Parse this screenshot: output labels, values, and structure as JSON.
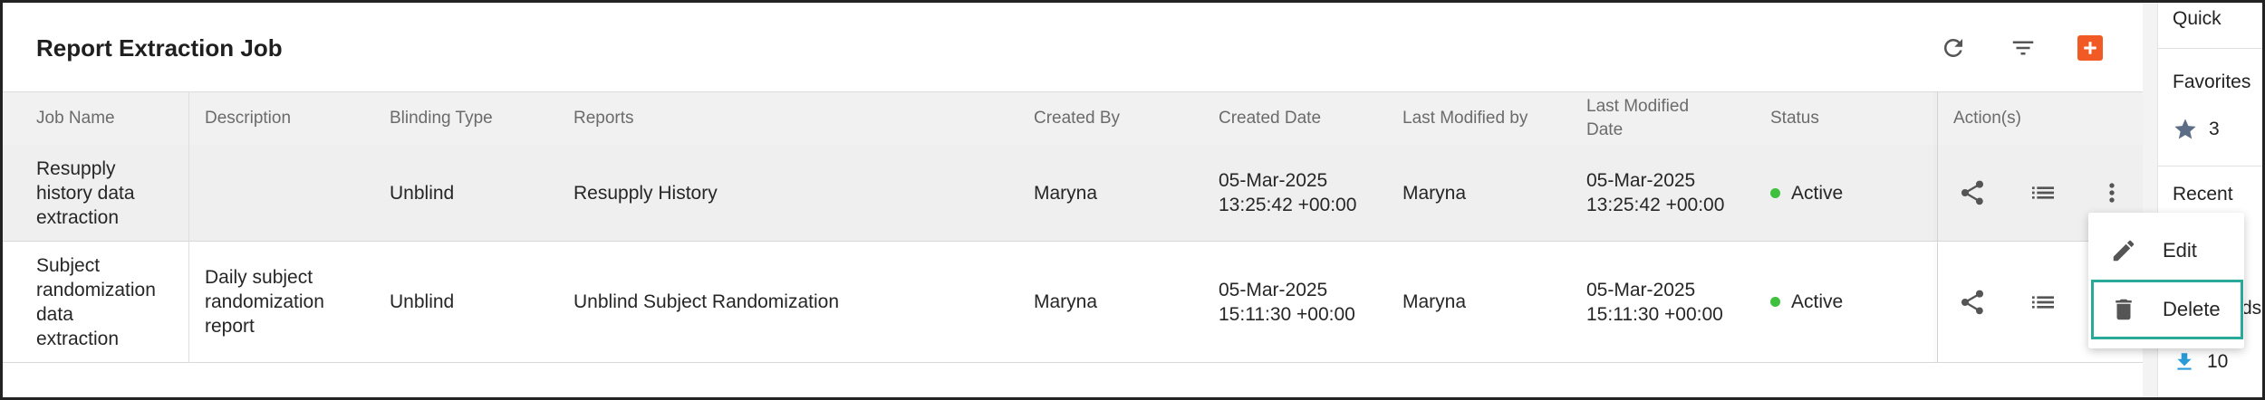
{
  "header": {
    "title": "Report Extraction Job",
    "icons": {
      "refresh": "refresh-icon",
      "filter": "filter-icon",
      "add": "add-icon"
    },
    "add_color": "#f15a24"
  },
  "table": {
    "columns": [
      "Job Name",
      "Description",
      "Blinding Type",
      "Reports",
      "Created By",
      "Created Date",
      "Last Modified by",
      "Last Modified Date",
      "Status",
      "Action(s)"
    ],
    "rows": [
      {
        "job_name": [
          "Resupply",
          "history data",
          "extraction"
        ],
        "description": [],
        "blinding_type": "Unblind",
        "reports": "Resupply History",
        "created_by": "Maryna",
        "created_date": [
          "05-Mar-2025",
          "13:25:42 +00:00"
        ],
        "last_modified_by": "Maryna",
        "last_modified_date": [
          "05-Mar-2025",
          "13:25:42 +00:00"
        ],
        "status": "Active"
      },
      {
        "job_name": [
          "Subject",
          "randomization",
          "data",
          "extraction"
        ],
        "description": [
          "Daily subject",
          "randomization",
          "report"
        ],
        "blinding_type": "Unblind",
        "reports": "Unblind Subject Randomization",
        "created_by": "Maryna",
        "created_date": [
          "05-Mar-2025",
          "15:11:30 +00:00"
        ],
        "last_modified_by": "Maryna",
        "last_modified_date": [
          "05-Mar-2025",
          "15:11:30 +00:00"
        ],
        "status": "Active"
      }
    ],
    "status_color": "#3fc13f"
  },
  "menu": {
    "edit_label": "Edit",
    "delete_label": "Delete"
  },
  "sidebar": {
    "quick": "Quick",
    "favorites": "Favorites",
    "favorites_count": "3",
    "recent": "Recent",
    "partial_text": "ds",
    "downloads_count": "10"
  }
}
